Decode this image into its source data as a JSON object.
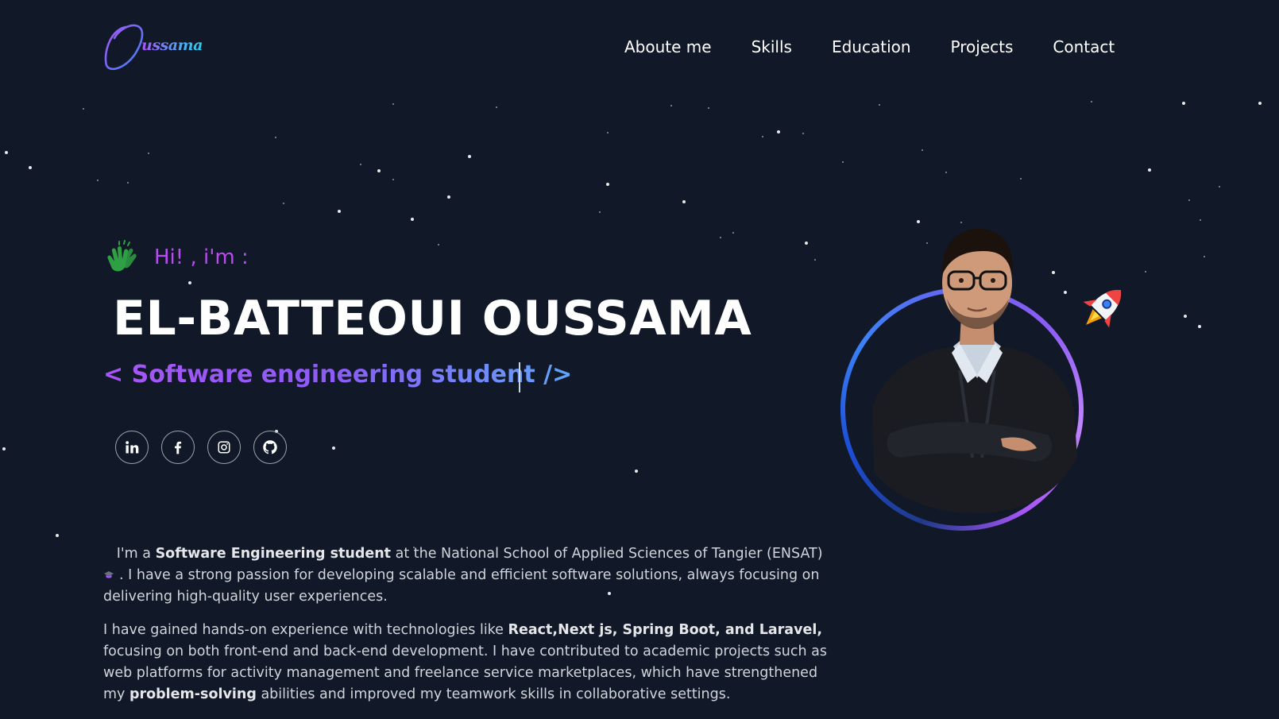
{
  "logo": {
    "text": "ussama",
    "icon": "signature-o-logo"
  },
  "nav": {
    "items": [
      {
        "label": "Aboute me"
      },
      {
        "label": "Skills"
      },
      {
        "label": "Education"
      },
      {
        "label": "Projects"
      },
      {
        "label": "Contact"
      }
    ]
  },
  "hero": {
    "greeting": "Hi! , i'm :",
    "name": "EL-BATTEOUI OUSSAMA",
    "role": "< Software engineering student />"
  },
  "socials": [
    {
      "icon": "linkedin-icon"
    },
    {
      "icon": "facebook-icon"
    },
    {
      "icon": "instagram-icon"
    },
    {
      "icon": "github-icon"
    }
  ],
  "about": {
    "p1_prefix": "I'm a ",
    "p1_bold": "Software Engineering student",
    "p1_mid": " at the National School of Applied Sciences of Tangier (ENSAT)",
    "p1_suffix": ". I have a strong passion for developing scalable and efficient software solutions, always focusing on delivering high-quality user experiences.",
    "p2_prefix": "I have gained hands-on experience with technologies like ",
    "p2_bold": "React,Next js, Spring Boot, and Laravel,",
    "p2_mid": " focusing on both front-end and back-end development. I have contributed to academic projects such as web platforms for activity management and freelance service marketplaces, which have strengthened my ",
    "p2_bold2": "problem-solving",
    "p2_suffix": " abilities and improved my teamwork skills in collaborative settings."
  },
  "colors": {
    "background": "#111827",
    "accent_purple": "#a855f7",
    "accent_blue": "#60a5fa"
  }
}
